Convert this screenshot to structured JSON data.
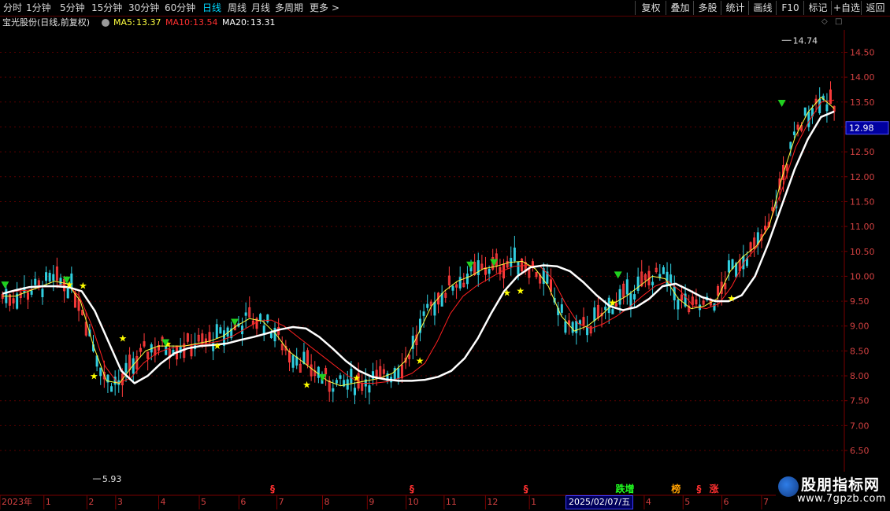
{
  "toolbar": {
    "left_tabs": [
      "分时",
      "1分钟",
      "5分钟",
      "15分钟",
      "30分钟",
      "60分钟",
      "日线",
      "周线",
      "月线",
      "多周期",
      "更多"
    ],
    "active_tab": "日线",
    "more_arrow": ">",
    "right_buttons": [
      "复权",
      "叠加",
      "多股",
      "统计",
      "画线",
      "F10",
      "标记",
      "+自选",
      "返回"
    ]
  },
  "info": {
    "stock": "宝光股份(日线,前复权)",
    "ma5_label": "MA5:",
    "ma5_value": "13.37",
    "ma10_label": "MA10:",
    "ma10_value": "13.54",
    "ma20_label": "MA20:",
    "ma20_value": "13.31"
  },
  "corner": {
    "diamond": "◇",
    "box": "□"
  },
  "colors": {
    "up": "#ff3b3b",
    "down": "#31cfe0",
    "ma5": "#ffff40",
    "ma10": "#ff2020",
    "ma20": "#ffffff",
    "axis": "#7a0000",
    "price_tag": "#0000a0"
  },
  "chart_data": {
    "type": "candlestick",
    "ylim": [
      5.6,
      14.95
    ],
    "y_ticks": [
      "14.50",
      "14.00",
      "13.50",
      "13.00",
      "12.50",
      "12.00",
      "11.50",
      "11.00",
      "10.50",
      "10.00",
      "9.50",
      "9.00",
      "8.50",
      "8.00",
      "7.50",
      "7.00",
      "6.50"
    ],
    "current_price": "12.98",
    "max_label": "14.74",
    "min_label": "5.93",
    "x_labels": [
      "2023年",
      "1",
      "2",
      "3",
      "4",
      "5",
      "6",
      "7",
      "8",
      "9",
      "10",
      "11",
      "12",
      "1",
      "2",
      "3",
      "4",
      "5",
      "6",
      "7"
    ],
    "cursor_date": "2025/02/07/五",
    "ma_lines": {
      "ma20": [
        9.65,
        9.72,
        9.78,
        9.8,
        9.8,
        9.78,
        9.7,
        9.3,
        8.7,
        8.1,
        7.85,
        8.0,
        8.25,
        8.45,
        8.55,
        8.6,
        8.62,
        8.65,
        8.72,
        8.78,
        8.85,
        8.93,
        8.98,
        8.95,
        8.78,
        8.55,
        8.3,
        8.1,
        7.98,
        7.93,
        7.9,
        7.9,
        7.92,
        7.98,
        8.1,
        8.35,
        8.75,
        9.25,
        9.7,
        10.0,
        10.18,
        10.22,
        10.2,
        10.1,
        9.88,
        9.62,
        9.4,
        9.32,
        9.38,
        9.55,
        9.8,
        9.85,
        9.72,
        9.58,
        9.5,
        9.5,
        9.62,
        10.0,
        10.65,
        11.4,
        12.15,
        12.75,
        13.2,
        13.31
      ],
      "ma10": [
        9.65,
        9.7,
        9.72,
        9.78,
        9.8,
        9.85,
        9.6,
        9.0,
        8.2,
        7.85,
        7.95,
        8.25,
        8.45,
        8.55,
        8.6,
        8.62,
        8.65,
        8.7,
        8.8,
        8.95,
        9.1,
        9.12,
        9.0,
        8.8,
        8.6,
        8.4,
        8.2,
        8.0,
        7.85,
        7.85,
        7.88,
        7.95,
        8.05,
        8.25,
        8.7,
        9.25,
        9.6,
        9.8,
        9.95,
        10.1,
        10.2,
        10.22,
        10.2,
        9.95,
        9.45,
        9.05,
        8.95,
        9.05,
        9.2,
        9.38,
        9.6,
        9.8,
        9.9,
        9.7,
        9.4,
        9.35,
        9.45,
        9.8,
        10.3,
        10.6,
        11.1,
        11.8,
        12.6,
        13.1,
        13.5,
        13.54
      ],
      "ma5": [
        9.6,
        9.6,
        9.7,
        9.8,
        9.9,
        9.85,
        9.5,
        8.6,
        7.9,
        7.85,
        8.2,
        8.5,
        8.6,
        8.6,
        8.6,
        8.65,
        8.7,
        8.8,
        9.0,
        9.15,
        9.1,
        8.85,
        8.5,
        8.3,
        8.1,
        7.9,
        7.8,
        7.85,
        7.9,
        7.95,
        8.05,
        8.3,
        8.85,
        9.4,
        9.7,
        9.9,
        10.0,
        10.15,
        10.2,
        10.28,
        10.3,
        10.15,
        9.8,
        9.2,
        8.9,
        9.0,
        9.2,
        9.45,
        9.6,
        9.8,
        10.0,
        9.95,
        9.55,
        9.35,
        9.4,
        9.55,
        10.1,
        10.4,
        10.6,
        11.0,
        12.0,
        12.8,
        13.3,
        13.6,
        13.37
      ]
    },
    "buy_signals": [
      [
        8.18,
        9.83
      ],
      [
        9.79,
        9.81
      ],
      [
        11.1,
        7.99
      ],
      [
        14.5,
        8.75
      ],
      [
        19.8,
        8.64
      ],
      [
        25.7,
        8.6
      ],
      [
        36.3,
        7.82
      ],
      [
        42.2,
        7.95
      ],
      [
        49.7,
        8.3
      ],
      [
        60.0,
        9.67
      ],
      [
        61.6,
        9.71
      ],
      [
        72.5,
        9.47
      ],
      [
        86.6,
        9.56
      ]
    ],
    "sell_signals": [
      [
        0.6,
        9.8
      ],
      [
        7.9,
        9.9
      ],
      [
        19.6,
        8.64
      ],
      [
        27.8,
        9.05
      ],
      [
        38.2,
        7.94
      ],
      [
        55.7,
        10.2
      ],
      [
        58.5,
        10.25
      ],
      [
        73.2,
        10.0
      ],
      [
        92.6,
        13.45
      ]
    ],
    "markers": [
      {
        "label": "§",
        "x": 32.0
      },
      {
        "label": "§",
        "x": 48.5
      },
      {
        "label": "§",
        "x": 62.0
      },
      {
        "label": "跌增",
        "x": 72.9,
        "color": "#20ff20"
      },
      {
        "label": "榜",
        "x": 79.5,
        "color": "#ffa000"
      },
      {
        "label": "§",
        "x": 82.5
      },
      {
        "label": "涨",
        "x": 84.0,
        "color": "#ff3030"
      }
    ]
  },
  "watermark": {
    "title": "股朋指标网",
    "url": "www.7gpzb.com"
  }
}
